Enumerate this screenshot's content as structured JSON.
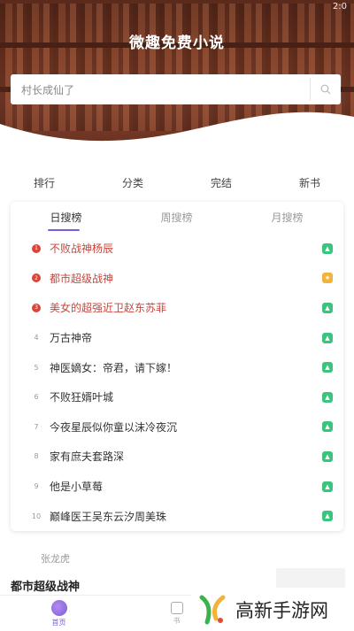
{
  "status_bar": {
    "time": "2:0"
  },
  "app": {
    "title": "微趣免费小说"
  },
  "search": {
    "placeholder": "村长成仙了"
  },
  "categories": [
    "排行",
    "分类",
    "完结",
    "新书"
  ],
  "rank_tabs": [
    "日搜榜",
    "周搜榜",
    "月搜榜"
  ],
  "rank_list": [
    {
      "num": "1",
      "title": "不败战神杨辰"
    },
    {
      "num": "2",
      "title": "都市超级战神"
    },
    {
      "num": "3",
      "title": "美女的超强近卫赵东苏菲"
    },
    {
      "num": "4",
      "title": "万古神帝"
    },
    {
      "num": "5",
      "title": "神医嫡女：帝君，请下嫁！"
    },
    {
      "num": "6",
      "title": "不败狂婿叶城"
    },
    {
      "num": "7",
      "title": "今夜星辰似你童以沫冷夜沉"
    },
    {
      "num": "8",
      "title": "家有庶夫套路深"
    },
    {
      "num": "9",
      "title": "他是小草莓"
    },
    {
      "num": "10",
      "title": "巅峰医王吴东云汐周美珠"
    }
  ],
  "rank_colors": {
    "top": "#d9453b",
    "badge_green": "#3ac47d",
    "badge_yellow": "#f2b33a"
  },
  "featured": {
    "author": "张龙虎",
    "section_title": "都市超级战神"
  },
  "tabbar": [
    {
      "label": "首页",
      "icon": "home-icon"
    },
    {
      "label": "书",
      "icon": "book-icon"
    }
  ],
  "watermark": {
    "text": "高新手游网"
  },
  "accent": "#7b5cd6"
}
